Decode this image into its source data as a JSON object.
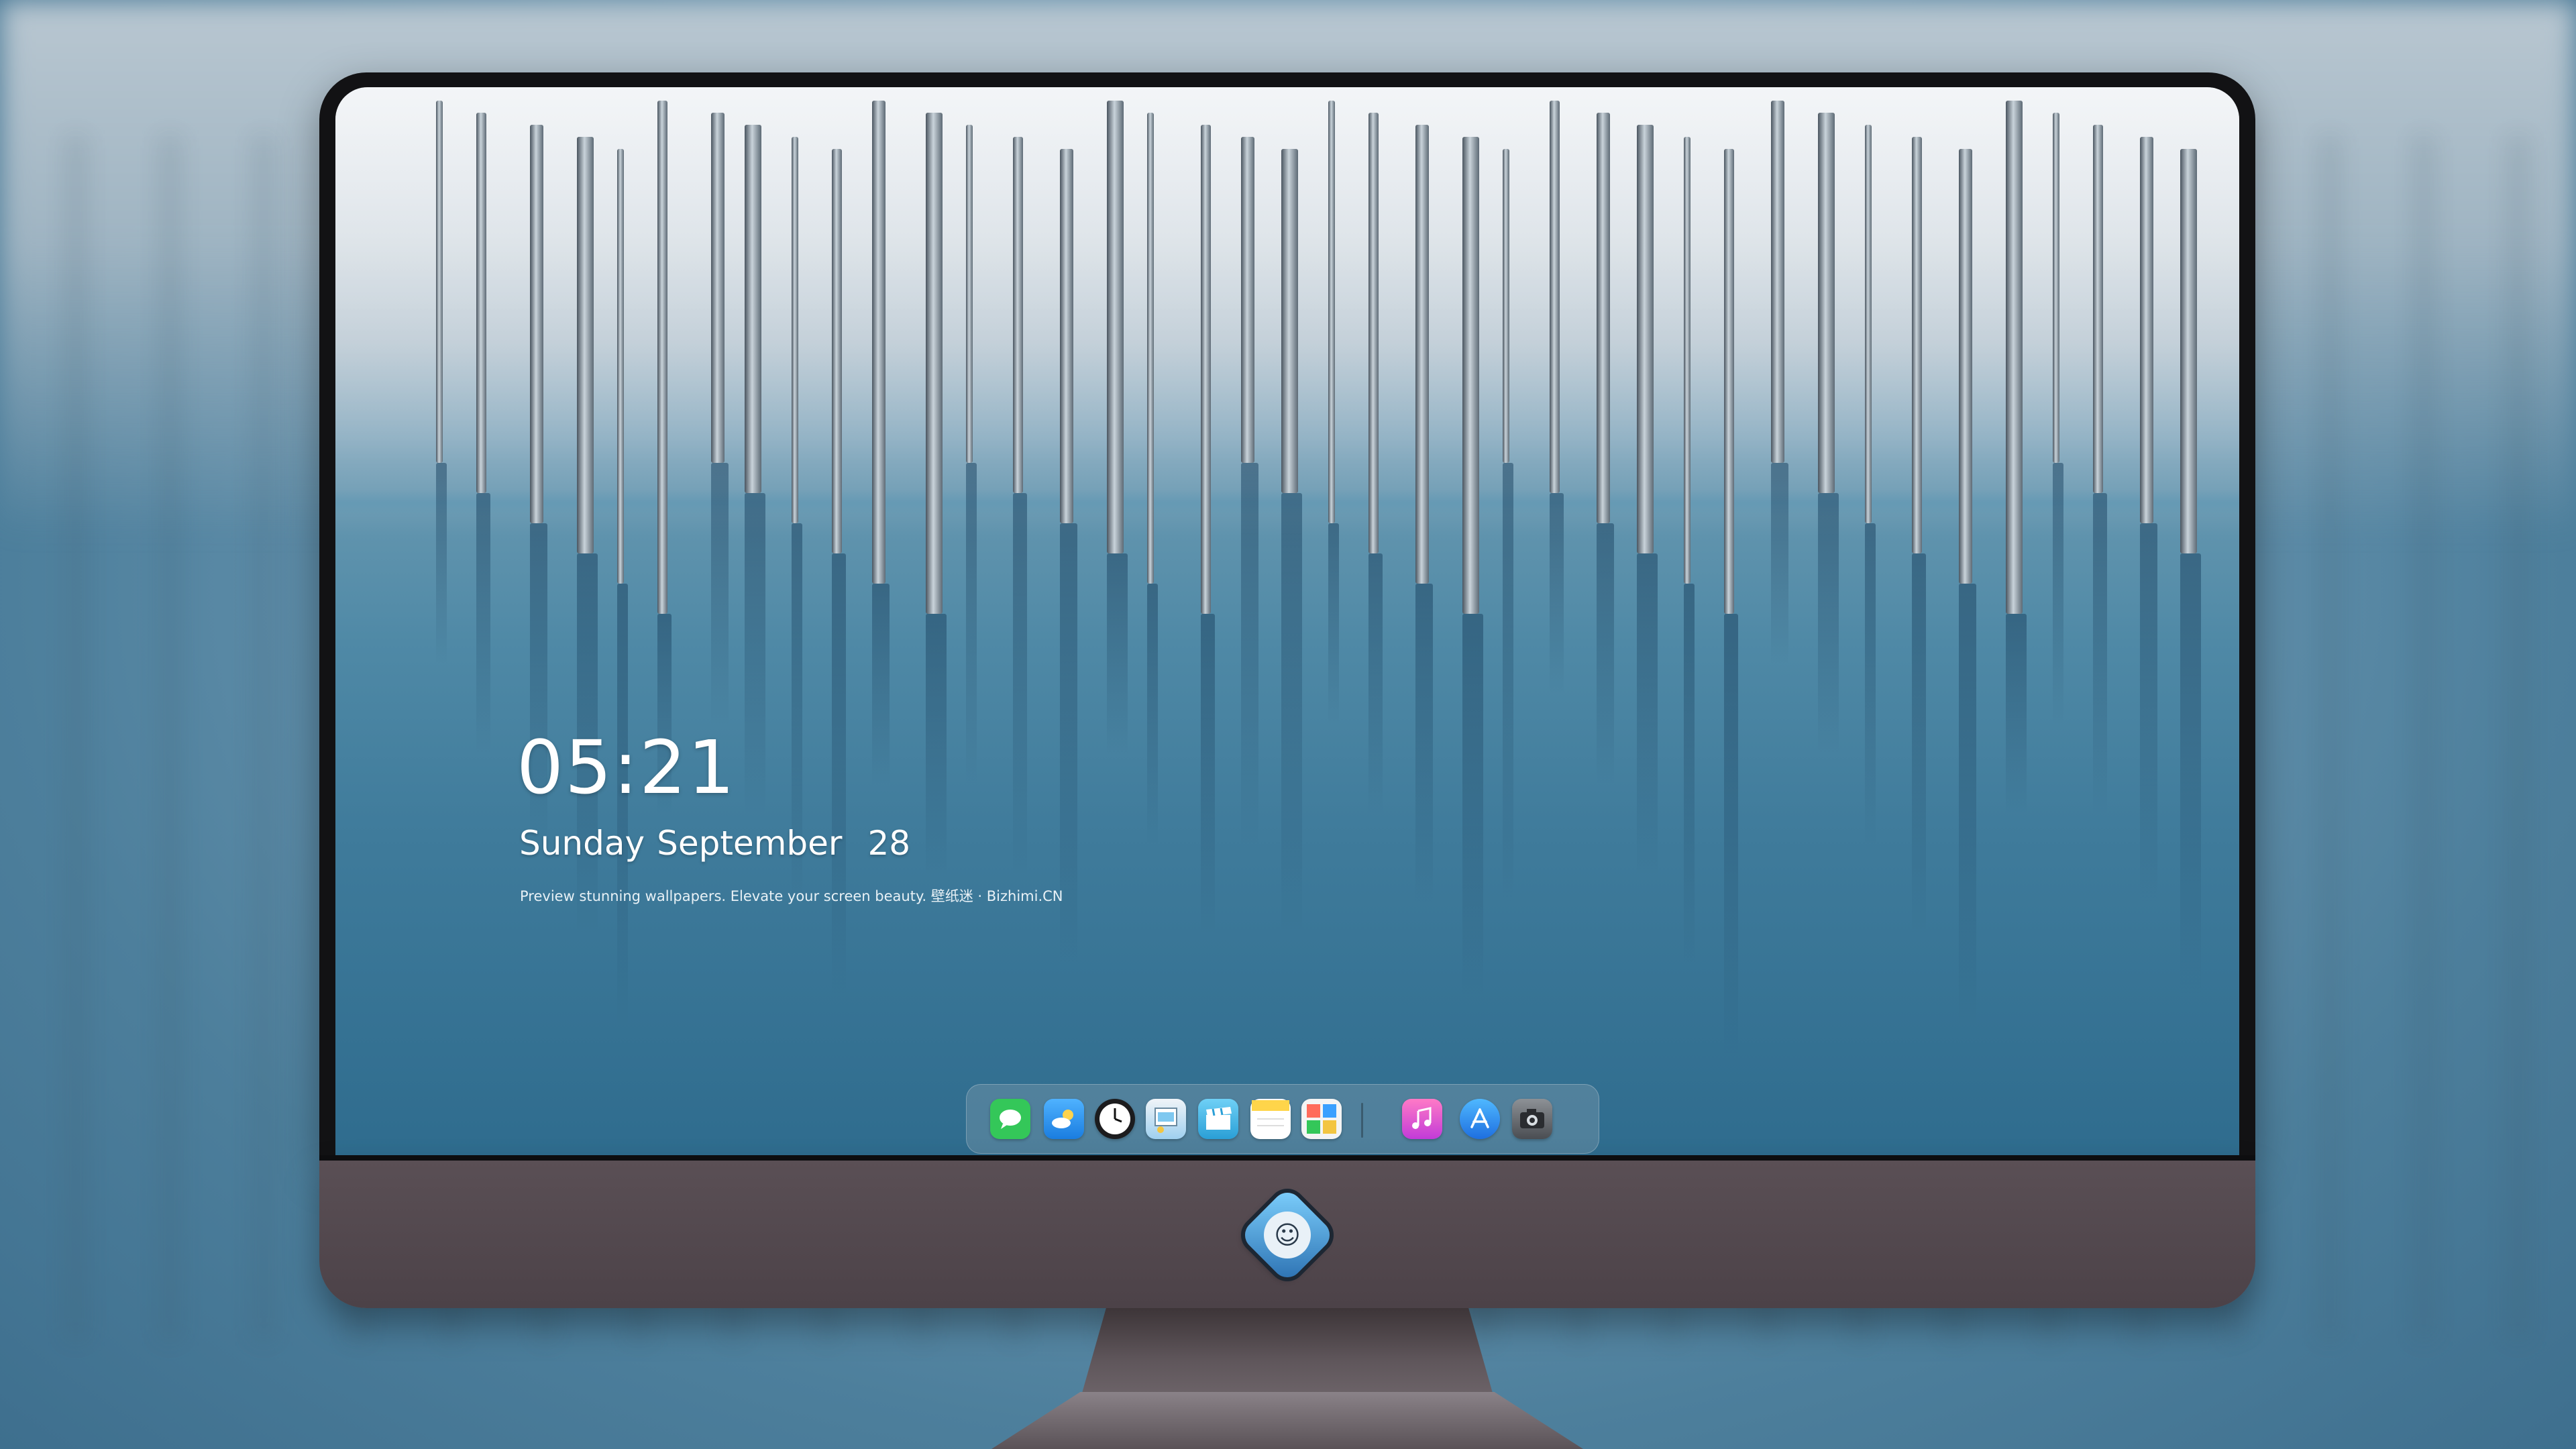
{
  "lockscreen": {
    "time": "05:21",
    "weekday": "Sunday",
    "month": "September",
    "day": "28",
    "tagline": "Preview stunning wallpapers. Elevate your screen beauty. 壁纸迷 · Bizhimi.CN"
  },
  "dock": {
    "apps": [
      {
        "name": "messages",
        "icon": "message-bubble-icon",
        "color": "#34c759"
      },
      {
        "name": "weather",
        "icon": "cloud-sun-icon",
        "color": "#3aa0ff"
      },
      {
        "name": "clock",
        "icon": "clock-icon",
        "color": "#1c1c1e"
      },
      {
        "name": "preview",
        "icon": "preview-icon",
        "color": "#6ab6e8"
      },
      {
        "name": "clips",
        "icon": "clapperboard-icon",
        "color": "#49b8e6"
      },
      {
        "name": "notes",
        "icon": "notes-icon",
        "color": "#ffd54a"
      },
      {
        "name": "photo-booth",
        "icon": "photo-grid-icon",
        "color": "#f3c541"
      },
      {
        "name": "music",
        "icon": "music-note-icon",
        "color": "#ff5fb4"
      },
      {
        "name": "app-store",
        "icon": "app-store-icon",
        "color": "#1e90ff"
      },
      {
        "name": "camera",
        "icon": "camera-icon",
        "color": "#5c5f63"
      }
    ]
  },
  "colors": {
    "bezel": "#121214",
    "chin": "#524850",
    "water": "#3f7b9b"
  }
}
